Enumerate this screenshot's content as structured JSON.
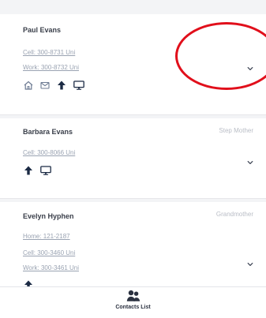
{
  "contacts": [
    {
      "name": "Paul Evans",
      "relation": "",
      "phones": [
        "Cell: 300-8731 Uni",
        "Work: 300-8732 Uni"
      ],
      "icons": [
        "home-icon",
        "mail-icon",
        "up-arrow-icon",
        "monitor-icon"
      ]
    },
    {
      "name": "Barbara Evans",
      "relation": "Step Mother",
      "phones": [
        "Cell: 300-8066 Uni"
      ],
      "icons": [
        "up-arrow-icon",
        "monitor-icon"
      ]
    },
    {
      "name": "Evelyn Hyphen",
      "relation": "Grandmother",
      "phones": [
        "Home: 121-2187",
        "Cell: 300-3460 Uni",
        "Work: 300-3461 Uni"
      ],
      "icons": [
        "up-arrow-icon"
      ]
    }
  ],
  "bottom_nav": {
    "label": "Contacts List",
    "icon": "contacts-icon"
  },
  "colors": {
    "name_text": "#3a3f4a",
    "link_text": "#9aa3b2",
    "relation_text": "#b9bdc6",
    "annotation_red": "#e10f1b",
    "icon_dark": "#1b2a44"
  }
}
